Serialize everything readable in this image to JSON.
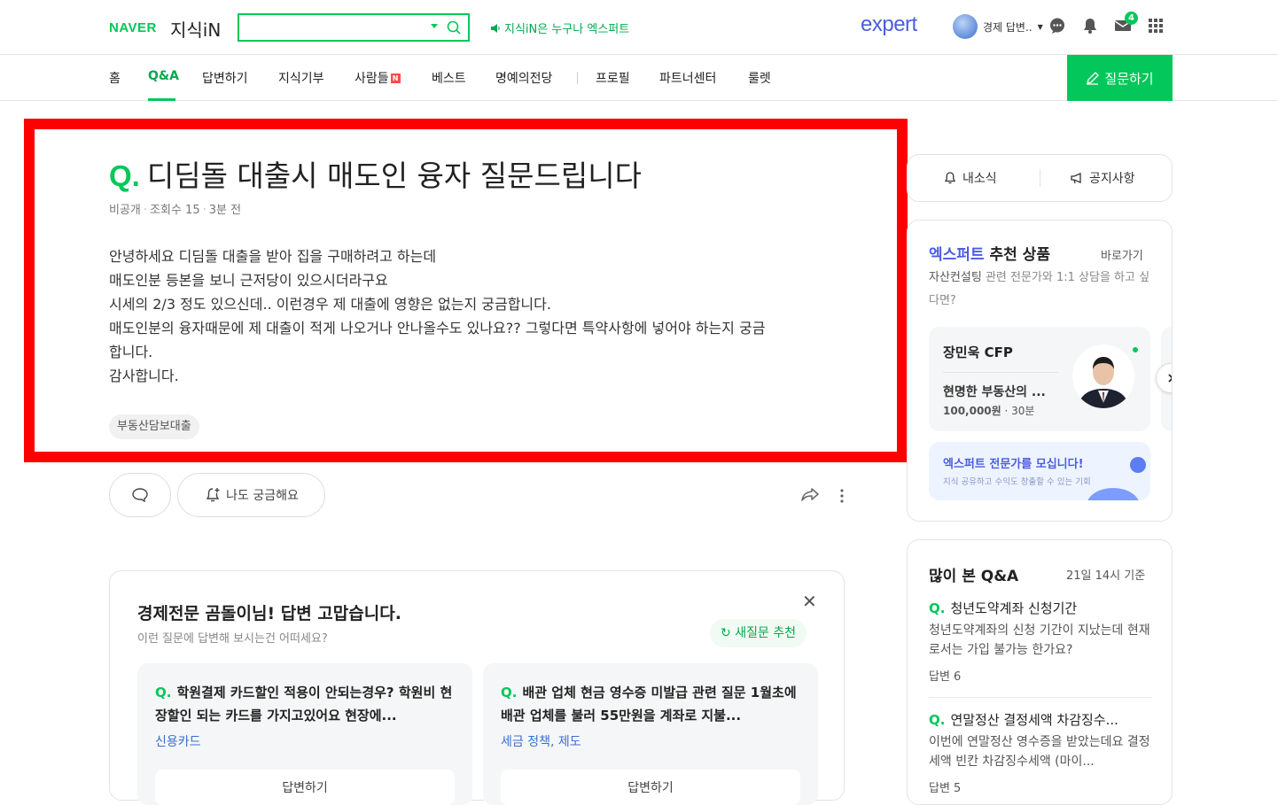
{
  "header": {
    "naver_logo": "NAVER",
    "service_logo": "지식iN",
    "search_placeholder": "",
    "promo_text": "지식iN은 누구나 엑스퍼트",
    "expert_logo": "expert",
    "user_name": "경제 답변..",
    "mail_count": "4"
  },
  "nav": {
    "items": [
      "홈",
      "Q&A",
      "답변하기",
      "지식기부",
      "사람들",
      "베스트",
      "명예의전당",
      "프로필",
      "파트너센터",
      "룰렛"
    ],
    "active": "Q&A",
    "new_badge": "N",
    "ask_button": "질문하기"
  },
  "question": {
    "q_mark": "Q.",
    "title": "디딤돌 대출시 매도인 융자 질문드립니다",
    "author": "비공개",
    "views": "조회수 15",
    "time": "3분 전",
    "body": [
      "안녕하세요 디딤돌 대출을 받아 집을 구매하려고 하는데",
      "매도인분 등본을 보니 근저당이 있으시더라구요",
      "시세의 2/3 정도 있으신데.. 이런경우 제 대출에 영향은 없는지 궁금합니다.",
      "매도인분의 융자때문에 제 대출이 적게 나오거나 안나올수도 있나요?? 그렇다면 특약사항에 넣어야 하는지 궁금",
      "합니다.",
      "감사합니다."
    ],
    "tag": "부동산담보대출",
    "curious_button": "나도 궁금해요"
  },
  "recommend": {
    "title": "경제전문 곰돌이님! 답변 고맙습니다.",
    "subtitle": "이런 질문에 답변해 보시는건 어떠세요?",
    "refresh": "새질문 추천",
    "cards": [
      {
        "question": "학원결제 카드할인 적용이 안되는경우? 학원비 현장할인 되는 카드를 가지고있어요 현장에...",
        "category": "신용카드",
        "answer_button": "답변하기"
      },
      {
        "question": "배관 업체 현금 영수증 미발급 관련 질문 1월초에 배관 업체를 불러 55만원을 계좌로 지불...",
        "category": "세금 정책, 제도",
        "answer_button": "답변하기"
      }
    ]
  },
  "sidebar": {
    "my_news": "내소식",
    "notice": "공지사항",
    "expert": {
      "title_blue": "엑스퍼트",
      "title_rest": " 추천 상품",
      "go": "바로가기",
      "desc_strong": "자산컨설팅",
      "desc_rest": " 관련 전문가와 1:1 상담을 하고 싶다면?",
      "pro_name": "장민욱 CFP",
      "pro_title": "현명한 부동산의 ...",
      "pro_price": "100,000원",
      "pro_time": "30분",
      "recruit_title": "엑스퍼트 전문가를 모십니다!",
      "recruit_sub": "지식 공유하고 수익도 창출할 수 있는 기회"
    },
    "popular": {
      "title": "많이 본 Q&A",
      "time": "21일 14시 기준",
      "items": [
        {
          "question": "청년도약계좌 신청기간",
          "desc": "청년도약계좌의 신청 기간이 지났는데 현재로서는 가입 불가능 한가요?",
          "answers": "답변 6"
        },
        {
          "question": "연말정산 결정세액 차감징수...",
          "desc": "이번에 연말정산 영수증을 받았는데요 결정세액 빈칸 차감징수세액 (마이...",
          "answers": "답변 5"
        }
      ]
    }
  },
  "colors": {
    "brand_green": "#03c75a",
    "expert_blue": "#4b5ddf",
    "highlight_red": "#ff0000"
  }
}
